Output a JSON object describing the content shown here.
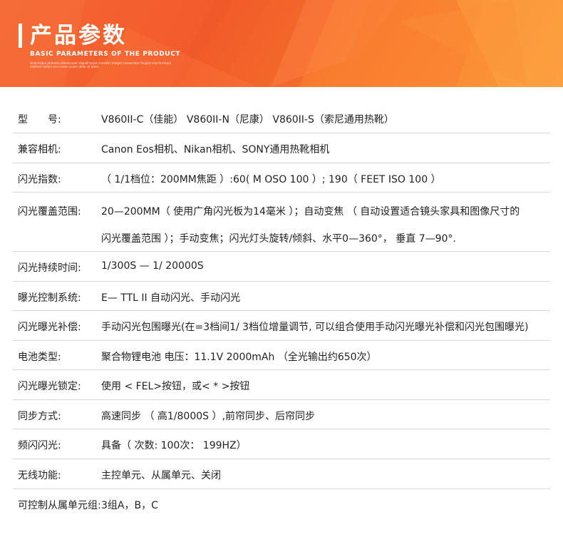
{
  "header": {
    "title": "产品参数",
    "subtitle": "BASIC PARAMETERS OF THE PRODUCT",
    "fine_print": "Scelerisque pharetra ullamcorper aliquet turpis convallis integer consectetur feugiat eros tincidunt eleifend nullam arcu lorem ipsum dolor sit amet"
  },
  "params": [
    {
      "label": "型　　号:",
      "value": "V860II-C（佳能）  V860II-N（尼康）  V860II-S（索尼通用热靴）"
    },
    {
      "label": "兼容相机:",
      "value": "Canon Eos相机、Nikan相机、SONY通用热靴相机"
    },
    {
      "label": "闪光指数:",
      "value": "（ 1/1档位：200MM焦距 ）:60( M OSO 100 ）;  190（  FEET   ISO   100  ）"
    },
    {
      "label": "闪光覆盖范围:",
      "value": "20—200MM（ 使用广角闪光板为14毫米 ）；自动变焦 （  自动设置适合镜头家具和图像尺寸的",
      "value2": "闪光覆盖范围 ）；手动变焦；闪光灯头旋转/倾斜、水平0—360°，  垂直 7—90°."
    },
    {
      "label": "闪光持续时间:",
      "value": "1/300S — 1/ 20000S"
    },
    {
      "label": "曝光控制系统:",
      "value": "E— TTL II 自动闪光、手动闪光"
    },
    {
      "label": "闪光曝光补偿:",
      "value": "手动闪光包围曝光(在=3档间1/ 3档位增量调节, 可以组合使用手动闪光曝光补偿和闪光包围曝光)"
    },
    {
      "label": "电池类型:",
      "value": "聚合物锂电池   电压：11.1V  2000mAh  （全光输出约650次）"
    },
    {
      "label": "闪光曝光锁定:",
      "value": "使用 < FEL>按钮，或< * >按钮"
    },
    {
      "label": "同步方式:",
      "value": "高速同步  （     高1/8000S ）,前帘同步、后帘同步"
    },
    {
      "label": "频闪闪光:",
      "value": "具备（ 次数: 100次：  199HZ）"
    },
    {
      "label": "无线功能:",
      "value": "主控单元、从属单元、关闭"
    },
    {
      "label": "可控制从属单元组:",
      "value": "3组A，B，C"
    }
  ]
}
